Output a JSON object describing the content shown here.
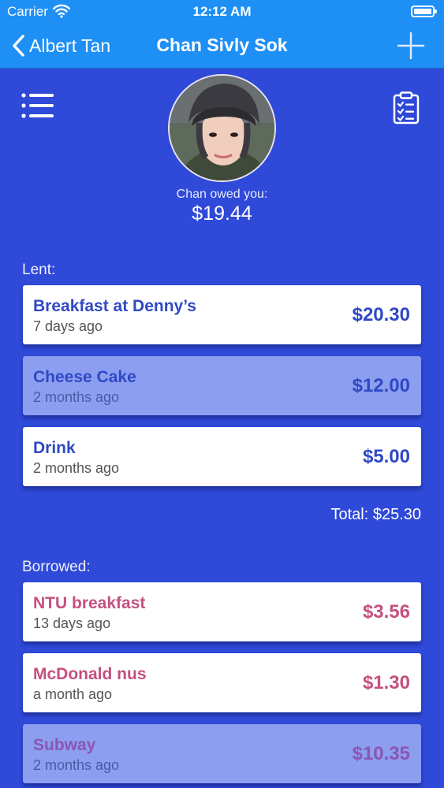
{
  "status_bar": {
    "carrier": "Carrier",
    "time": "12:12 AM",
    "icons": [
      "wifi-icon",
      "battery-icon"
    ]
  },
  "nav": {
    "back_label": "Albert Tan",
    "title": "Chan Sivly Sok",
    "icons": [
      "chevron-left-icon",
      "plus-icon"
    ]
  },
  "toolbar_icons": [
    "list-icon",
    "clipboard-checklist-icon"
  ],
  "profile": {
    "owed_label": "Chan owed you:",
    "owed_amount": "$19.44"
  },
  "lent": {
    "label": "Lent:",
    "items": [
      {
        "title": "Breakfast at Denny’s",
        "time": "7 days ago",
        "amount": "$20.30",
        "highlighted": false
      },
      {
        "title": "Cheese Cake",
        "time": "2 months ago",
        "amount": "$12.00",
        "highlighted": true
      },
      {
        "title": "Drink",
        "time": "2 months ago",
        "amount": "$5.00",
        "highlighted": false
      }
    ],
    "total": "Total: $25.30"
  },
  "borrowed": {
    "label": "Borrowed:",
    "items": [
      {
        "title": "NTU breakfast",
        "time": "13 days ago",
        "amount": "$3.56",
        "highlighted": false
      },
      {
        "title": "McDonald nus",
        "time": "a month ago",
        "amount": "$1.30",
        "highlighted": false
      },
      {
        "title": "Subway",
        "time": "2 months ago",
        "amount": "$10.35",
        "highlighted": true
      }
    ]
  },
  "colors": {
    "background": "#2f49d8",
    "nav_bar": "#1e8ff5",
    "lent_text": "#2f49c5",
    "borrowed_text": "#c5507f",
    "highlighted_card": "#8c9ef0"
  }
}
